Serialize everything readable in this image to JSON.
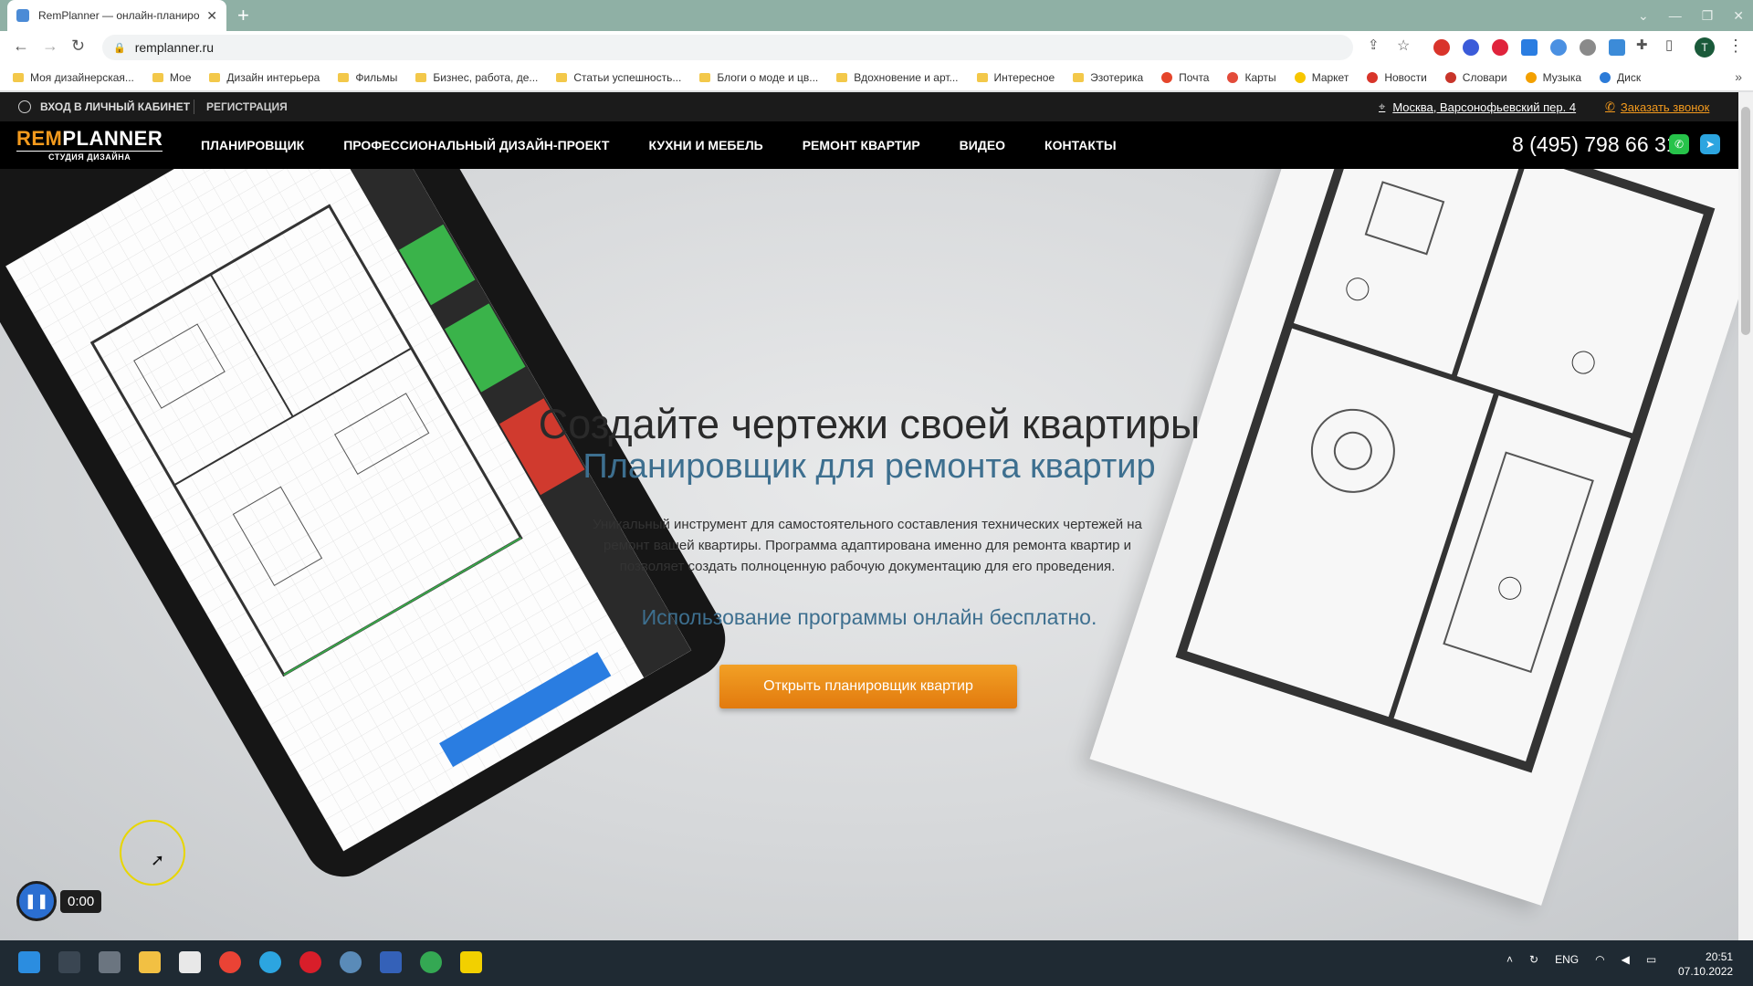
{
  "browser": {
    "tab_title": "RemPlanner — онлайн-планиро",
    "url": "remplanner.ru",
    "bookmarks": [
      {
        "label": "Моя дизайнерская...",
        "kind": "folder"
      },
      {
        "label": "Мое",
        "kind": "folder"
      },
      {
        "label": "Дизайн интерьера",
        "kind": "folder"
      },
      {
        "label": "Фильмы",
        "kind": "folder"
      },
      {
        "label": "Бизнес, работа, де...",
        "kind": "folder"
      },
      {
        "label": "Статьи успешность...",
        "kind": "folder"
      },
      {
        "label": "Блоги о моде и цв...",
        "kind": "folder"
      },
      {
        "label": "Вдохновение и арт...",
        "kind": "folder"
      },
      {
        "label": "Интересное",
        "kind": "folder"
      },
      {
        "label": "Эзотерика",
        "kind": "folder"
      },
      {
        "label": "Почта",
        "kind": "site",
        "color": "#e5452b"
      },
      {
        "label": "Карты",
        "kind": "site",
        "color": "#e34b3a"
      },
      {
        "label": "Маркет",
        "kind": "site",
        "color": "#f7c600"
      },
      {
        "label": "Новости",
        "kind": "site",
        "color": "#d8352a"
      },
      {
        "label": "Словари",
        "kind": "site",
        "color": "#c8352a"
      },
      {
        "label": "Музыка",
        "kind": "site",
        "color": "#f3a000"
      },
      {
        "label": "Диск",
        "kind": "site",
        "color": "#2c7bd8"
      }
    ],
    "profile_initial": "T"
  },
  "site": {
    "topbar": {
      "login": "ВХОД В ЛИЧНЫЙ КАБИНЕТ",
      "register": "РЕГИСТРАЦИЯ",
      "address": "Москва, Варсонофьевский пер. 4",
      "callback": "Заказать звонок"
    },
    "logo": {
      "main_a": "REM",
      "main_b": "PLANNER",
      "sub": "СТУДИЯ ДИЗАЙНА"
    },
    "menu": [
      "ПЛАНИРОВЩИК",
      "ПРОФЕССИОНАЛЬНЫЙ ДИЗАЙН-ПРОЕКТ",
      "КУХНИ И МЕБЕЛЬ",
      "РЕМОНТ КВАРТИР",
      "ВИДЕО",
      "КОНТАКТЫ"
    ],
    "phone": "8 (495) 798 66 31",
    "hero": {
      "title": "Создайте чертежи своей квартиры",
      "subtitle": "Планировщик для ремонта квартир",
      "description": "Уникальный инструмент для самостоятельного составления технических чертежей на ремонт вашей квартиры. Программа адаптирована именно для ремонта квартир и позволяет создать полноценную рабочую документацию для его проведения.",
      "free_note": "Использование программы онлайн бесплатно.",
      "cta": "Открыть планировщик квартир"
    },
    "accent_color": "#f39a1d",
    "blue_text_color": "#3d6f8f"
  },
  "recorder": {
    "time": "0:00"
  },
  "taskbar": {
    "tray_lang": "ENG",
    "time": "20:51",
    "date": "07.10.2022"
  }
}
